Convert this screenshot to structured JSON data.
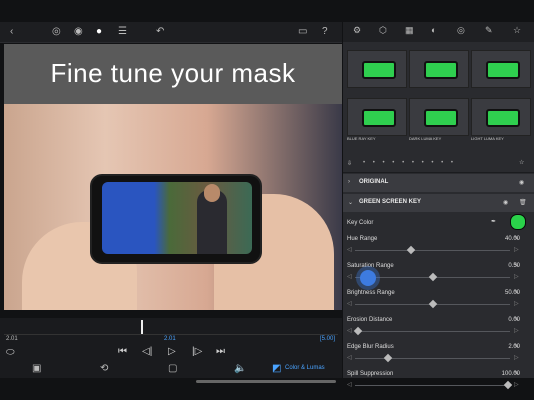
{
  "headline": "Fine tune your mask",
  "timeline": {
    "current_time_left": "2.01",
    "current_time_mid": "2.01",
    "duration": "[5.00]"
  },
  "bottom_bar": {
    "color_lumas_label": "Color & Lumas"
  },
  "presets": [
    {
      "label": "",
      "screen": "green"
    },
    {
      "label": "",
      "screen": "green"
    },
    {
      "label": "",
      "screen": "green"
    },
    {
      "label": "BLUE RAY KEY",
      "screen": "green"
    },
    {
      "label": "DARK LUMA KEY",
      "screen": "green"
    },
    {
      "label": "LIGHT LUMA KEY",
      "screen": "green"
    }
  ],
  "sections": {
    "original": "ORIGINAL",
    "green_screen_key": "GREEN SCREEN KEY"
  },
  "key_color": {
    "label": "Key Color",
    "color": "#2ad14a"
  },
  "params": [
    {
      "label": "Hue Range",
      "value": "40.00",
      "level": 0.35
    },
    {
      "label": "Saturation Range",
      "value": "0.50",
      "level": 0.5
    },
    {
      "label": "Brightness Range",
      "value": "50.00",
      "level": 0.5
    },
    {
      "label": "Erosion Distance",
      "value": "0.00",
      "level": 0.0
    },
    {
      "label": "Edge Blur Radius",
      "value": "2.00",
      "level": 0.2
    },
    {
      "label": "Spill Suppression",
      "value": "100.00",
      "level": 1.0
    }
  ]
}
